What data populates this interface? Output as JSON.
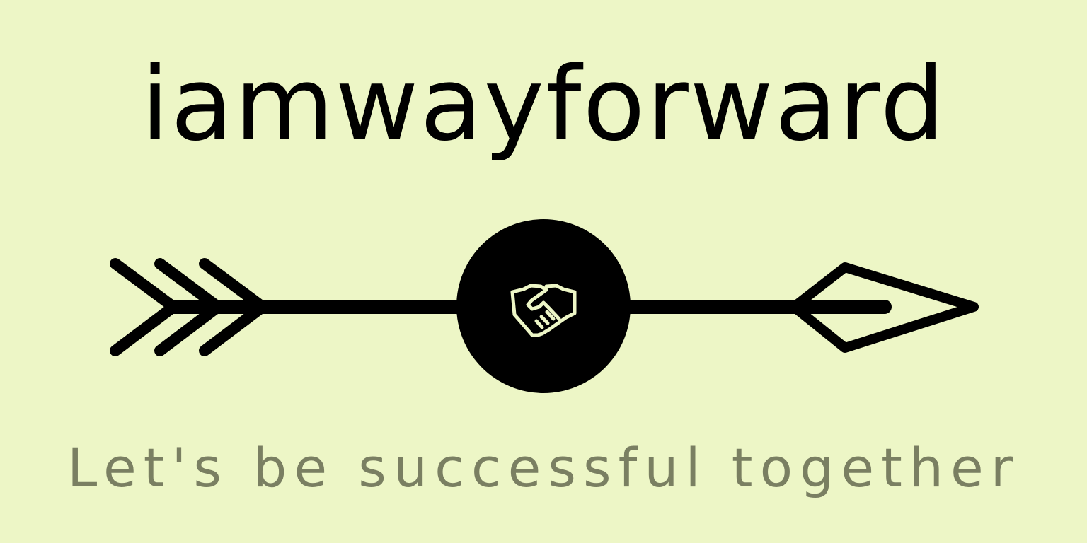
{
  "logo": {
    "title": "iamwayforward",
    "tagline": "Let's be successful together",
    "emblem_icon": "handshake-icon"
  },
  "colors": {
    "background": "#edf6c6",
    "foreground": "#000000",
    "tagline": "#7a7f62"
  }
}
